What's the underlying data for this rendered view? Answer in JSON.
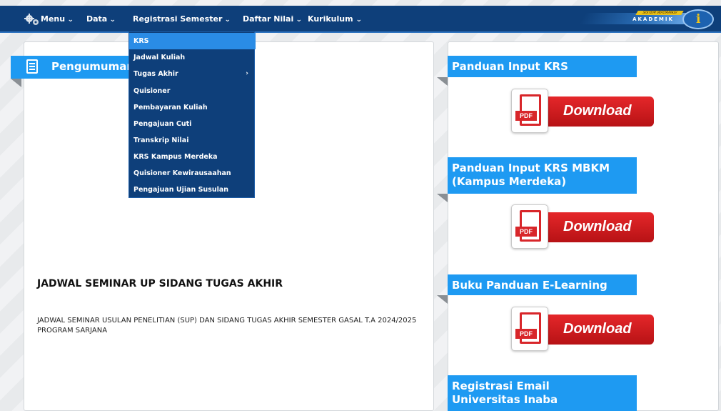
{
  "nav": {
    "menu": "Menu",
    "data": "Data",
    "registrasi": "Registrasi Semester",
    "daftar_nilai": "Daftar Nilai",
    "kurikulum": "Kurikulum",
    "caret": "⌄"
  },
  "brand": {
    "top": "SISTEM INFORMASI",
    "name": "AKADEMIK",
    "logo": "i"
  },
  "dropdown": {
    "items": [
      {
        "label": "KRS"
      },
      {
        "label": "Jadwal Kuliah"
      },
      {
        "label": "Tugas Akhir",
        "arrow": "›"
      },
      {
        "label": "Quisioner"
      },
      {
        "label": "Pembayaran Kuliah"
      },
      {
        "label": "Pengajuan Cuti"
      },
      {
        "label": "Transkrip Nilai"
      },
      {
        "label": "KRS Kampus Merdeka"
      },
      {
        "label": "Quisioner Kewirausaahan"
      },
      {
        "label": "Pengajuan Ujian Susulan"
      }
    ]
  },
  "announcement": {
    "title": "Pengumuman",
    "seminar_title": "JADWAL SEMINAR UP SIDANG TUGAS AKHIR",
    "seminar_body": "JADWAL SEMINAR USULAN PENELITIAN (SUP) DAN SIDANG TUGAS AKHIR SEMESTER GASAL T.A 2024/2025 PROGRAM SARJANA"
  },
  "side": {
    "guide1": "Panduan Input KRS",
    "guide2_line1": "Panduan Input KRS MBKM",
    "guide2_line2": "(Kampus Merdeka)",
    "guide3": "Buku Panduan E-Learning",
    "guide4_line1": "Registrasi Email",
    "guide4_line2": "Universitas Inaba",
    "download_label": "Download",
    "pdf_label": "PDF"
  }
}
